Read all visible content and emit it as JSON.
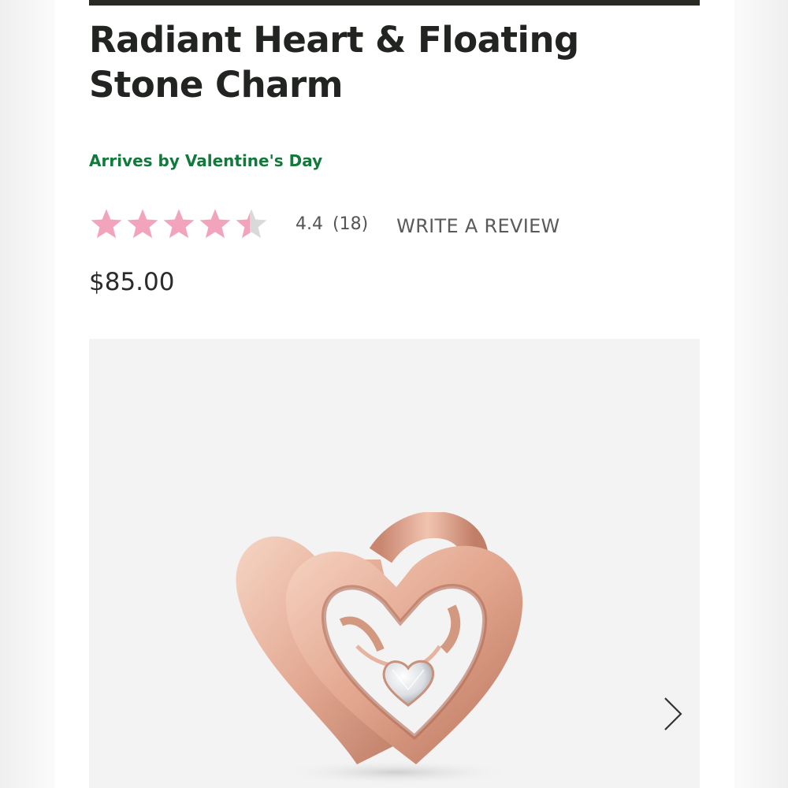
{
  "product": {
    "title": "Radiant Heart & Floating Stone Charm",
    "arrival_message": "Arrives by Valentine's Day",
    "price": "$85.00"
  },
  "rating": {
    "value": "4.4",
    "count": "(18)",
    "stars_filled_fraction": 0.88,
    "write_review_label": "WRITE A REVIEW"
  },
  "colors": {
    "star_filled": "#f2a4bd",
    "star_empty": "#d9d9d9",
    "arrival_green": "#117a3b",
    "title": "#222421",
    "topbar": "#2a2a24",
    "rose_gold": "#e8b09a"
  },
  "gallery": {
    "image_name": "rose-gold-heart-charm-photo",
    "next_icon": "chevron-right-icon"
  }
}
